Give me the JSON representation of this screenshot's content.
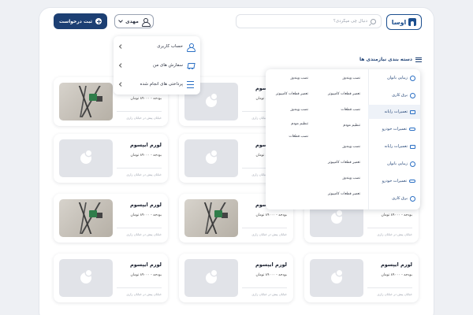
{
  "header": {
    "logo_text": "اوسا",
    "search_placeholder": "دنبال چی میگردی؟",
    "user_name": "مهدی",
    "cta_label": "ثبت درخواست"
  },
  "user_menu": {
    "items": [
      {
        "label": "حساب کاربری",
        "icon": "user-icon"
      },
      {
        "label": "سفارش های من",
        "icon": "cart-icon"
      },
      {
        "label": "پرداختی های انجام شده",
        "icon": "list-icon"
      }
    ]
  },
  "categories": {
    "title": "دسته بندی نیازمندی ها",
    "side_items": [
      {
        "label": "زیبایی بانوان",
        "icon": "beauty-icon"
      },
      {
        "label": "برق کاری",
        "icon": "electric-icon"
      },
      {
        "label": "تعمیرات رایانه",
        "icon": "computer-icon"
      },
      {
        "label": "تعمیرات خودرو",
        "icon": "car-icon"
      },
      {
        "label": "تعمیرات رایانه",
        "icon": "computer-icon"
      },
      {
        "label": "زیبایی بانوان",
        "icon": "beauty-icon"
      },
      {
        "label": "تعمیرات خودرو",
        "icon": "car-icon"
      },
      {
        "label": "برق کاری",
        "icon": "electric-icon"
      }
    ],
    "sub_col1": [
      "نصب ویندوز",
      "تعمیر قطعات کامپیوتر",
      "نصب قطعات",
      "تنظیم مودم",
      "نصب ویندوز",
      "تعمیر قطعات کامپیوتر",
      "نصب ویندوز",
      "تعمیر قطعات کامپیوتر"
    ],
    "sub_col2": [
      "نصب ویندوز",
      "تعمیر قطعات کامپیوتر",
      "نصب ویندوز",
      "تنظیم مودم",
      "نصب قطعات"
    ]
  },
  "cards": {
    "title": "لورم ایپسوم",
    "budget": "بودجه - ۸۹۰۰۰ تومان",
    "location": "خیابان پیش در خیابان زاری"
  }
}
